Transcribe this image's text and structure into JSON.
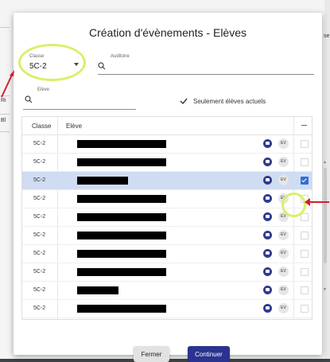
{
  "dialog": {
    "title": "Création d'évènements - Elèves",
    "classe_label": "Classe",
    "classe_value": "5C-2",
    "auditoire_label": "Auditoire",
    "eleve_label": "Elève",
    "current_only_label": "Seulement élèves actuels",
    "current_only_checked": true
  },
  "table": {
    "headers": [
      "Classe",
      "Elève"
    ],
    "rows": [
      {
        "classe": "5C-2",
        "ev": "EV",
        "selected": false
      },
      {
        "classe": "5C-2",
        "ev": "EV",
        "selected": false
      },
      {
        "classe": "5C-2",
        "ev": "EV",
        "selected": true
      },
      {
        "classe": "5C-2",
        "ev": "EV",
        "selected": false
      },
      {
        "classe": "5C-2",
        "ev": "EV",
        "selected": false
      },
      {
        "classe": "5C-2",
        "ev": "EV",
        "selected": false
      },
      {
        "classe": "5C-2",
        "ev": "EV",
        "selected": false
      },
      {
        "classe": "5C-2",
        "ev": "EV",
        "selected": false
      },
      {
        "classe": "5C-2",
        "ev": "EV",
        "selected": false
      },
      {
        "classe": "5C-2",
        "ev": "EV",
        "selected": false
      }
    ]
  },
  "buttons": {
    "close": "Fermer",
    "continue": "Continuer"
  },
  "background": {
    "left_letters": [
      "Ri",
      "Bl"
    ],
    "right_letters": "se"
  },
  "colors": {
    "primary": "#2a338f",
    "selected_row": "#cfdcf2",
    "highlight": "#d8f06a",
    "arrow": "#d11f2b"
  },
  "icons": [
    "chevron-down-icon",
    "search-icon",
    "checkbox-icon",
    "person-icon",
    "ev-badge",
    "scroll-up-icon",
    "scroll-down-icon"
  ]
}
